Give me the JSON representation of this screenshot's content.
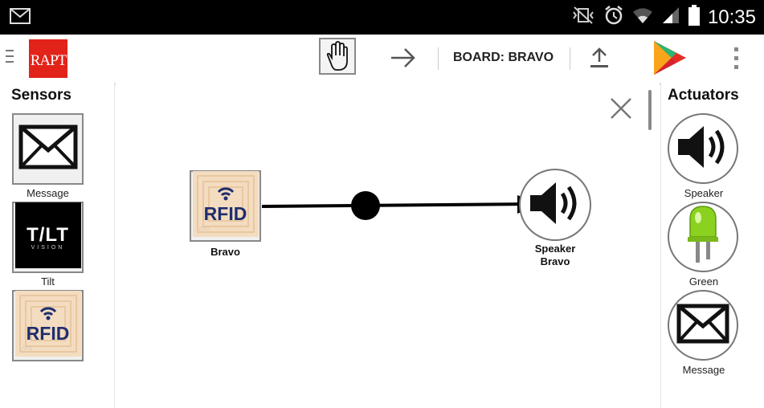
{
  "status_bar": {
    "time": "10:35",
    "icons": [
      "gmail-icon",
      "mute-vibrate-icon",
      "alarm-icon",
      "wifi-icon",
      "signal-icon",
      "battery-icon"
    ]
  },
  "action_bar": {
    "logo_text": "RAPT",
    "board_label": "BOARD: BRAVO",
    "icons": [
      "menu-icon",
      "hand-icon",
      "arrow-right-icon",
      "upload-icon",
      "play-store-icon",
      "overflow-menu-icon"
    ]
  },
  "sensors": {
    "title": "Sensors",
    "items": [
      {
        "label": "Message",
        "icon": "envelope-icon"
      },
      {
        "label": "Tilt",
        "icon": "tilt-vision-icon"
      },
      {
        "label": "",
        "icon": "rfid-icon"
      }
    ]
  },
  "actuators": {
    "title": "Actuators",
    "items": [
      {
        "label": "Speaker",
        "icon": "speaker-icon"
      },
      {
        "label": "Green",
        "icon": "green-led-icon"
      },
      {
        "label": "Message",
        "icon": "envelope-icon"
      }
    ]
  },
  "canvas": {
    "source_node": {
      "label": "Bravo",
      "icon": "rfid-icon"
    },
    "target_node": {
      "label_line1": "Speaker",
      "label_line2": "Bravo",
      "icon": "speaker-icon"
    }
  },
  "rfid_text": "RFID",
  "tilt_text": "T/LT",
  "tilt_subtext": "VISION",
  "colors": {
    "brand_red": "#e2231a",
    "led_green": "#8bd11f",
    "status_bar": "#000000"
  }
}
